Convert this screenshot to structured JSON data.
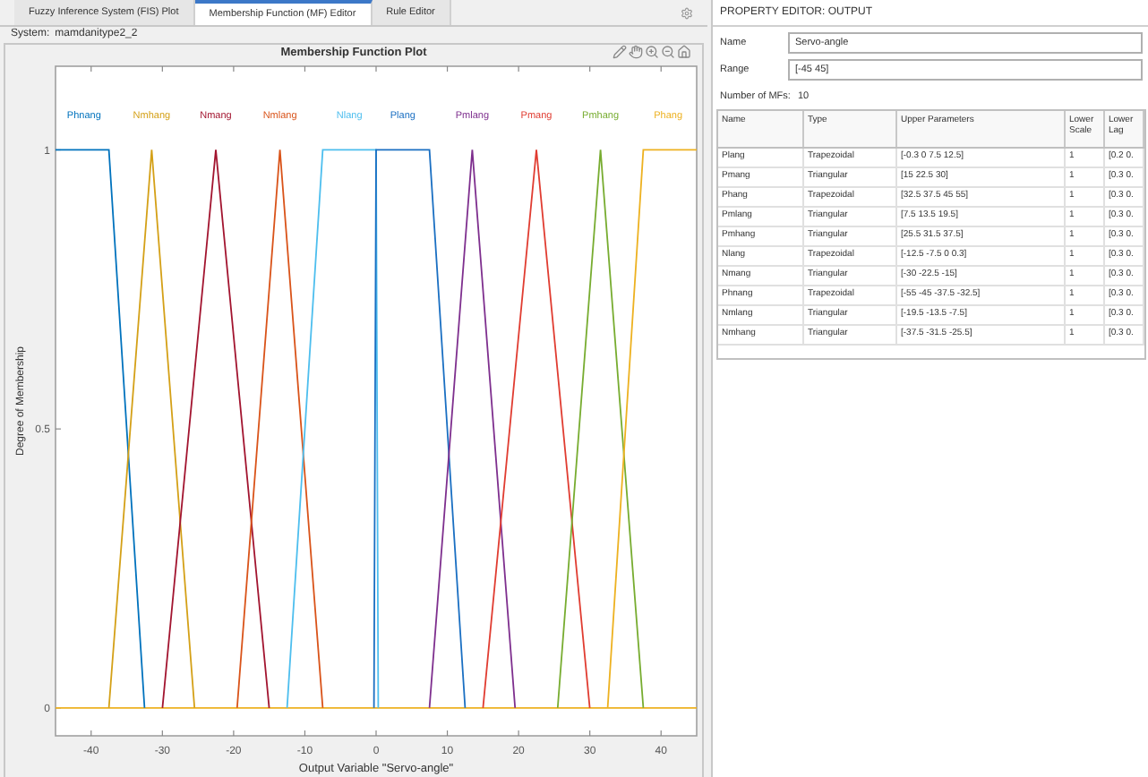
{
  "tabs": [
    {
      "label": "Fuzzy Inference System (FIS) Plot",
      "selected": false
    },
    {
      "label": "Membership Function (MF) Editor",
      "selected": true
    },
    {
      "label": "Rule Editor",
      "selected": false
    }
  ],
  "system": {
    "label": "System:",
    "value": "mamdanitype2_2"
  },
  "plot": {
    "title": "Membership Function Plot",
    "chart_data": {
      "type": "line",
      "xlabel": "Output Variable \"Servo-angle\"",
      "ylabel": "Degree of Membership",
      "xlim": [
        -45,
        45
      ],
      "ylim": [
        -0.05,
        1.15
      ],
      "xticks": [
        -40,
        -30,
        -20,
        -10,
        0,
        10,
        20,
        30,
        40
      ],
      "yticks": [
        0,
        0.5,
        1
      ],
      "ref_lines": [
        {
          "axis": "y",
          "value": 0,
          "color": "#edb120"
        }
      ],
      "series": [
        {
          "name": "Phnang",
          "color": "#0072bd",
          "x": [
            -45,
            -37.5,
            -32.5
          ],
          "values": [
            1,
            1,
            0
          ]
        },
        {
          "name": "Nmhang",
          "color": "#d4a017",
          "x": [
            -37.5,
            -31.5,
            -25.5
          ],
          "values": [
            0,
            1,
            0
          ]
        },
        {
          "name": "Nmang",
          "color": "#a2142f",
          "x": [
            -30,
            -22.5,
            -15
          ],
          "values": [
            0,
            1,
            0
          ]
        },
        {
          "name": "Nmlang",
          "color": "#d95319",
          "x": [
            -19.5,
            -13.5,
            -7.5
          ],
          "values": [
            0,
            1,
            0
          ]
        },
        {
          "name": "Nlang",
          "color": "#4dbeee",
          "x": [
            -12.5,
            -7.5,
            0,
            0.3
          ],
          "values": [
            0,
            1,
            1,
            0
          ]
        },
        {
          "name": "Plang",
          "color": "#1a6fc2",
          "x": [
            -0.3,
            0,
            7.5,
            12.5
          ],
          "values": [
            0,
            1,
            1,
            0
          ]
        },
        {
          "name": "Pmlang",
          "color": "#7e2f8e",
          "x": [
            7.5,
            13.5,
            19.5
          ],
          "values": [
            0,
            1,
            0
          ]
        },
        {
          "name": "Pmang",
          "color": "#e03c31",
          "x": [
            15,
            22.5,
            30
          ],
          "values": [
            0,
            1,
            0
          ]
        },
        {
          "name": "Pmhang",
          "color": "#77ac30",
          "x": [
            25.5,
            31.5,
            37.5
          ],
          "values": [
            0,
            1,
            0
          ]
        },
        {
          "name": "Phang",
          "color": "#edb120",
          "x": [
            32.5,
            37.5,
            45
          ],
          "values": [
            0,
            1,
            1
          ]
        }
      ]
    }
  },
  "editor": {
    "title": "PROPERTY EDITOR: OUTPUT",
    "fields": [
      {
        "label": "Name",
        "value": "Servo-angle"
      },
      {
        "label": "Range",
        "value": "[-45 45]"
      }
    ],
    "mf_count": {
      "label": "Number of MFs:",
      "value": "10"
    },
    "table": {
      "columns": [
        "Name",
        "Type",
        "Upper Parameters",
        "Lower Scale",
        "Lower Lag"
      ],
      "rows": [
        [
          "Plang",
          "Trapezoidal",
          "[-0.3 0 7.5 12.5]",
          "1",
          "[0.2 0."
        ],
        [
          "Pmang",
          "Triangular",
          "[15 22.5 30]",
          "1",
          "[0.3 0."
        ],
        [
          "Phang",
          "Trapezoidal",
          "[32.5 37.5 45 55]",
          "1",
          "[0.3 0."
        ],
        [
          "Pmlang",
          "Triangular",
          "[7.5 13.5 19.5]",
          "1",
          "[0.3 0."
        ],
        [
          "Pmhang",
          "Triangular",
          "[25.5 31.5 37.5]",
          "1",
          "[0.3 0."
        ],
        [
          "Nlang",
          "Trapezoidal",
          "[-12.5 -7.5 0 0.3]",
          "1",
          "[0.3 0."
        ],
        [
          "Nmang",
          "Triangular",
          "[-30 -22.5 -15]",
          "1",
          "[0.3 0."
        ],
        [
          "Phnang",
          "Trapezoidal",
          "[-55 -45 -37.5 -32.5]",
          "1",
          "[0.3 0."
        ],
        [
          "Nmlang",
          "Triangular",
          "[-19.5 -13.5 -7.5]",
          "1",
          "[0.3 0."
        ],
        [
          "Nmhang",
          "Triangular",
          "[-37.5 -31.5 -25.5]",
          "1",
          "[0.3 0."
        ]
      ]
    }
  }
}
